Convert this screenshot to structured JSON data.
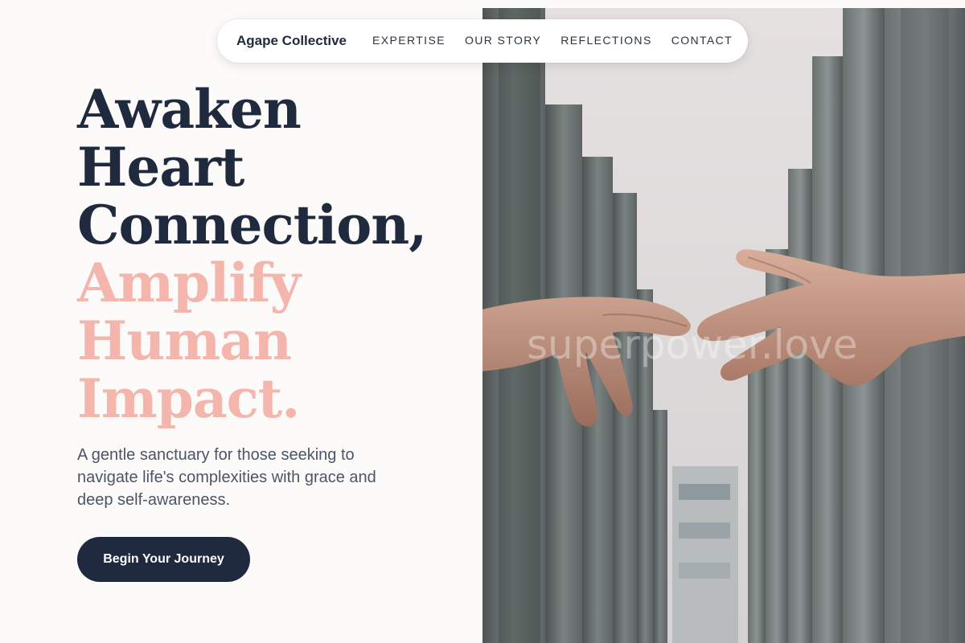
{
  "nav": {
    "brand": "Agape Collective",
    "links": [
      "EXPERTISE",
      "OUR STORY",
      "REFLECTIONS",
      "CONTACT"
    ]
  },
  "hero": {
    "headline_lines": [
      "Awaken",
      "Heart",
      "Connection,"
    ],
    "accent_lines": [
      "Amplify",
      "Human",
      "Impact."
    ],
    "subtext": "A gentle sanctuary for those seeking to navigate life's complexities with grace and deep self-awareness.",
    "cta_label": "Begin Your Journey"
  },
  "image": {
    "watermark": "superpower.love",
    "subject": "two hands reaching toward each other between concrete pillars"
  },
  "colors": {
    "navy": "#1f2a3f",
    "accent_pink": "#f4b6ac",
    "body_text": "#4b5567",
    "background": "#fcfbfa"
  }
}
